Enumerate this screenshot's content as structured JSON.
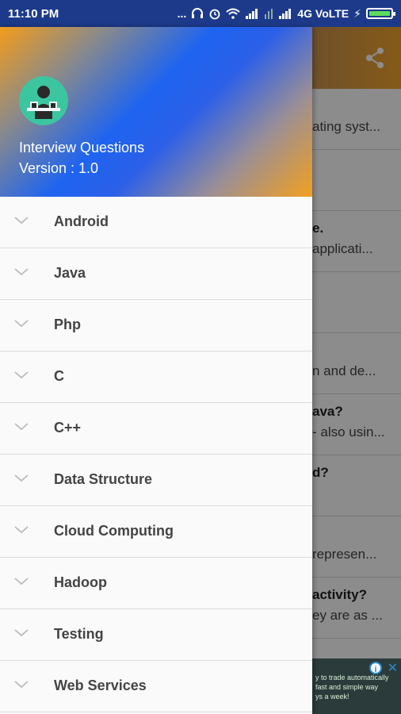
{
  "status_bar": {
    "time": "11:10 PM",
    "dots": "...",
    "network": "4G VoLTE",
    "icons": [
      "headphones-icon",
      "alarm-icon",
      "wifi-icon",
      "signal-icon",
      "signal-icon",
      "charging-icon",
      "battery-icon"
    ]
  },
  "background": {
    "rows": [
      {
        "title": "",
        "sub": "ating syst..."
      },
      {
        "title": "",
        "sub": ""
      },
      {
        "title": "e.",
        "sub": "applicati..."
      },
      {
        "title": "",
        "sub": ""
      },
      {
        "title": "",
        "sub": "n and de..."
      },
      {
        "title": "ava?",
        "sub": "- also usin..."
      },
      {
        "title": "d?",
        "sub": ""
      },
      {
        "title": "",
        "sub": "represen..."
      },
      {
        "title": "activity?",
        "sub": "ey are as ..."
      }
    ],
    "ad_text": "y to trade automatically\nfast and simple way\nys a week!"
  },
  "drawer": {
    "app_name": "Interview Questions",
    "version": "Version : 1.0",
    "items": [
      {
        "label": "Android"
      },
      {
        "label": "Java"
      },
      {
        "label": "Php"
      },
      {
        "label": "C"
      },
      {
        "label": "C++"
      },
      {
        "label": "Data Structure"
      },
      {
        "label": "Cloud Computing"
      },
      {
        "label": "Hadoop"
      },
      {
        "label": "Testing"
      },
      {
        "label": "Web Services"
      }
    ]
  },
  "colors": {
    "status_bar": "#1d3a8a",
    "toolbar_left": "#3a4fd0",
    "toolbar_right": "#f2a52a",
    "menu_text": "#444444"
  }
}
